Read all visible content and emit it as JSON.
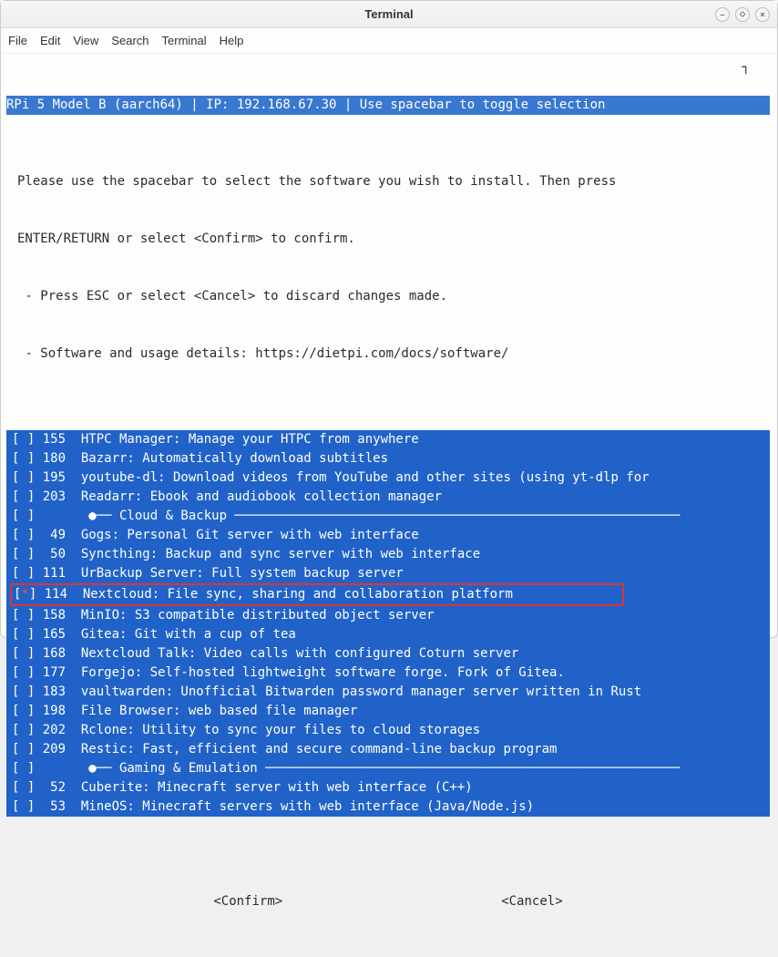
{
  "window": {
    "title": "Terminal"
  },
  "menubar": {
    "file": "File",
    "edit": "Edit",
    "view": "View",
    "search": "Search",
    "terminal": "Terminal",
    "help": "Help"
  },
  "header_line": "RPi 5 Model B (aarch64) | IP: 192.168.67.30 | Use spacebar to toggle selection",
  "intro": {
    "l1": "Please use the spacebar to select the software you wish to install. Then press",
    "l2": "ENTER/RETURN or select <Confirm> to confirm.",
    "l3": " - Press ESC or select <Cancel> to discard changes made.",
    "l4": " - Software and usage details: https://dietpi.com/docs/software/"
  },
  "items": [
    {
      "mark": " ",
      "id": "155",
      "text": "HTPC Manager: Manage your HTPC from anywhere"
    },
    {
      "mark": " ",
      "id": "180",
      "text": "Bazarr: Automatically download subtitles"
    },
    {
      "mark": " ",
      "id": "195",
      "text": "youtube-dl: Download videos from YouTube and other sites (using yt-dlp for"
    },
    {
      "mark": " ",
      "id": "203",
      "text": "Readarr: Ebook and audiobook collection manager"
    },
    {
      "mark": " ",
      "id": "",
      "text": "●── Cloud & Backup ──────────────────────────────────────────────────────────",
      "category": true
    },
    {
      "mark": " ",
      "id": "49",
      "text": "Gogs: Personal Git server with web interface"
    },
    {
      "mark": " ",
      "id": "50",
      "text": "Syncthing: Backup and sync server with web interface"
    },
    {
      "mark": " ",
      "id": "111",
      "text": "UrBackup Server: Full system backup server"
    },
    {
      "mark": "*",
      "id": "114",
      "text": "Nextcloud: File sync, sharing and collaboration platform",
      "highlighted": true
    },
    {
      "mark": " ",
      "id": "158",
      "text": "MinIO: S3 compatible distributed object server"
    },
    {
      "mark": " ",
      "id": "165",
      "text": "Gitea: Git with a cup of tea"
    },
    {
      "mark": " ",
      "id": "168",
      "text": "Nextcloud Talk: Video calls with configured Coturn server"
    },
    {
      "mark": " ",
      "id": "177",
      "text": "Forgejo: Self-hosted lightweight software forge. Fork of Gitea."
    },
    {
      "mark": " ",
      "id": "183",
      "text": "vaultwarden: Unofficial Bitwarden password manager server written in Rust"
    },
    {
      "mark": " ",
      "id": "198",
      "text": "File Browser: web based file manager"
    },
    {
      "mark": " ",
      "id": "202",
      "text": "Rclone: Utility to sync your files to cloud storages"
    },
    {
      "mark": " ",
      "id": "209",
      "text": "Restic: Fast, efficient and secure command-line backup program"
    },
    {
      "mark": " ",
      "id": "",
      "text": "●── Gaming & Emulation ──────────────────────────────────────────────────────",
      "category": true
    },
    {
      "mark": " ",
      "id": "52",
      "text": "Cuberite: Minecraft server with web interface (C++)"
    },
    {
      "mark": " ",
      "id": "53",
      "text": "MineOS: Minecraft servers with web interface (Java/Node.js)"
    }
  ],
  "buttons": {
    "confirm": "<Confirm>",
    "cancel": "<Cancel>"
  }
}
